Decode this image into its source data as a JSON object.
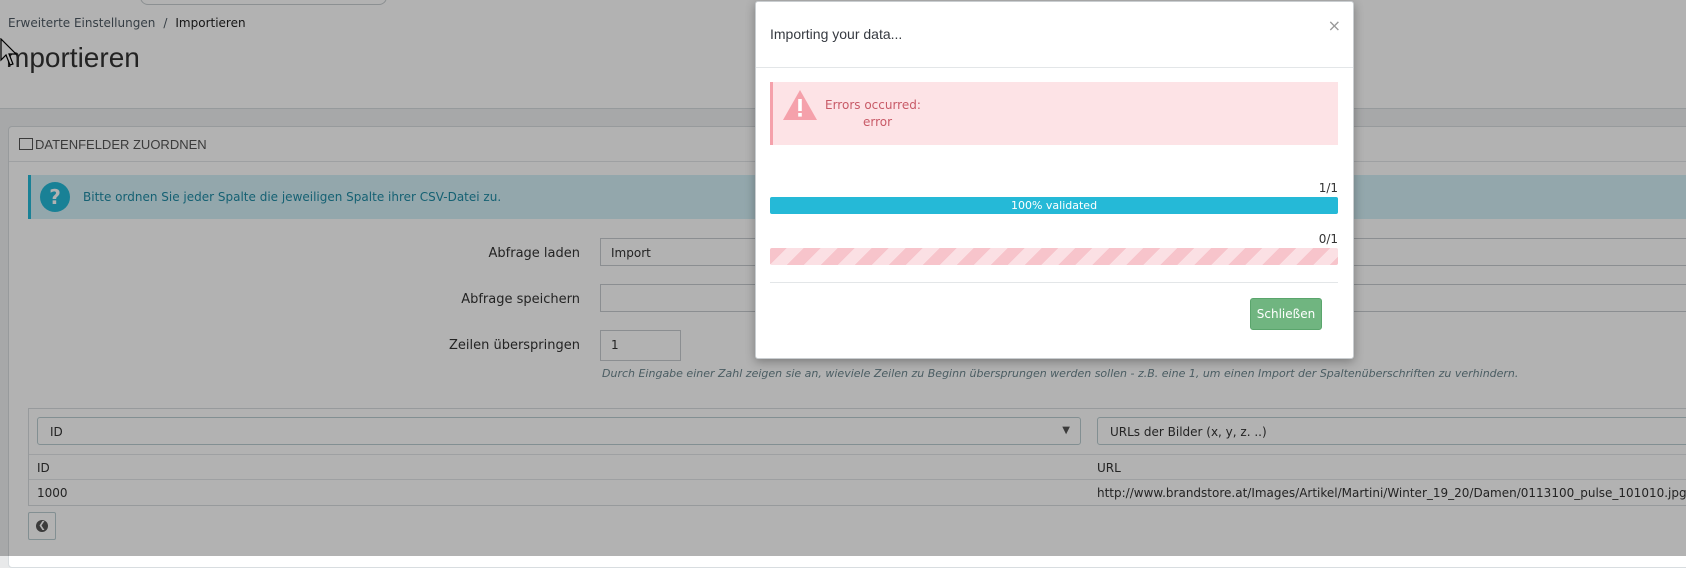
{
  "breadcrumb": {
    "parent": "Erweiterte Einstellungen",
    "separator": "/",
    "current": "Importieren"
  },
  "page": {
    "title": "mportieren"
  },
  "panel": {
    "title": "DATENFELDER ZUORDNEN",
    "info_text": "Bitte ordnen Sie jeder Spalte die jeweiligen Spalte ihrer CSV-Datei zu.",
    "info_icon": "question-icon"
  },
  "form": {
    "load_query_label": "Abfrage laden",
    "load_query_value": "Import",
    "save_query_label": "Abfrage speichern",
    "save_query_value": "",
    "skip_rows_label": "Zeilen überspringen",
    "skip_rows_value": "1",
    "hint": "Durch Eingabe einer Zahl zeigen sie an, wieviele Zeilen zu Beginn übersprungen werden sollen - z.B. eine 1, um einen Import der Spaltenüberschriften zu verhindern."
  },
  "mapping": {
    "select_1": "ID",
    "select_2": "URLs der Bilder (x, y, z. ..)",
    "headers": [
      "ID",
      "URL"
    ],
    "row": [
      "1000",
      "http://www.brandstore.at/Images/Artikel/Martini/Winter_19_20/Damen/0113100_pulse_101010.jpg"
    ]
  },
  "modal": {
    "title": "Importing your data...",
    "close_glyph": "×",
    "error_line1": "Errors occurred:",
    "error_line2": "error",
    "validate_count": "1/1",
    "validate_label": "100% validated",
    "validate_percent": 100,
    "import_count": "0/1",
    "import_percent": 0,
    "close_button": "Schließen"
  },
  "colors": {
    "accent": "#25b9d7",
    "success": "#70b580",
    "danger_bg": "#fde3e6",
    "danger_text": "#c85a67"
  }
}
